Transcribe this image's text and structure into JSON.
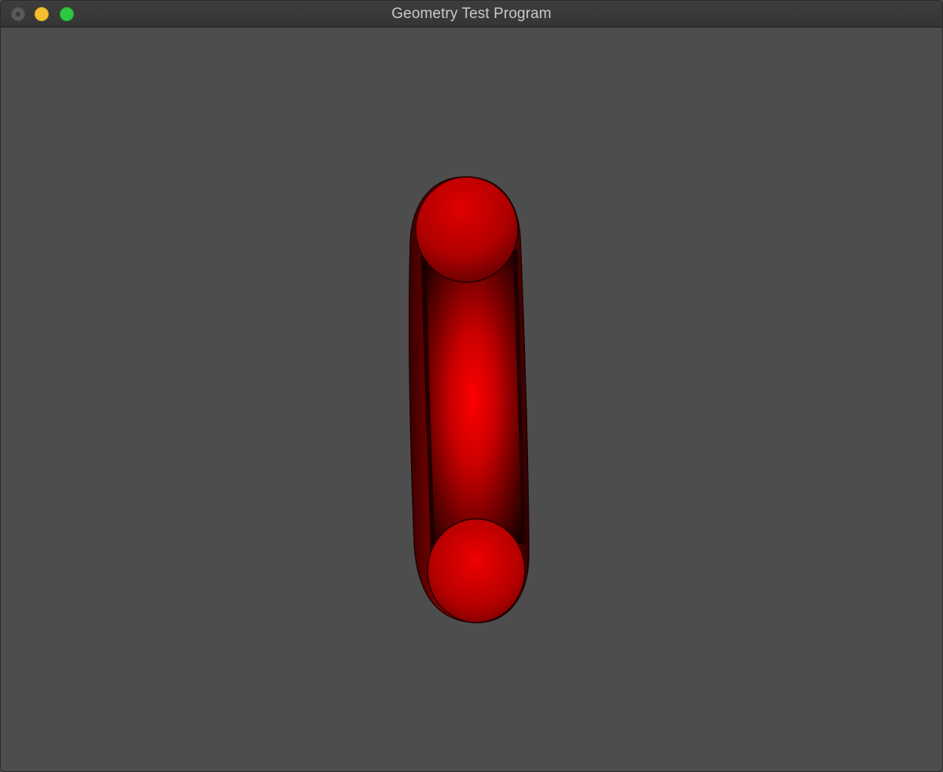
{
  "window": {
    "title": "Geometry Test Program",
    "buttons": {
      "close": "close-button",
      "minimize": "minimize-button",
      "zoom": "zoom-button"
    },
    "colors": {
      "background": "#4d4d4d",
      "titlebar": "#383838",
      "title_text": "#c9c9c9",
      "close": "#5a5a5a",
      "minimize": "#f5bf2f",
      "zoom": "#2ec840"
    }
  },
  "scene": {
    "object": "torus",
    "material_color": "#ff0000",
    "background_color": "#4d4d4d"
  }
}
